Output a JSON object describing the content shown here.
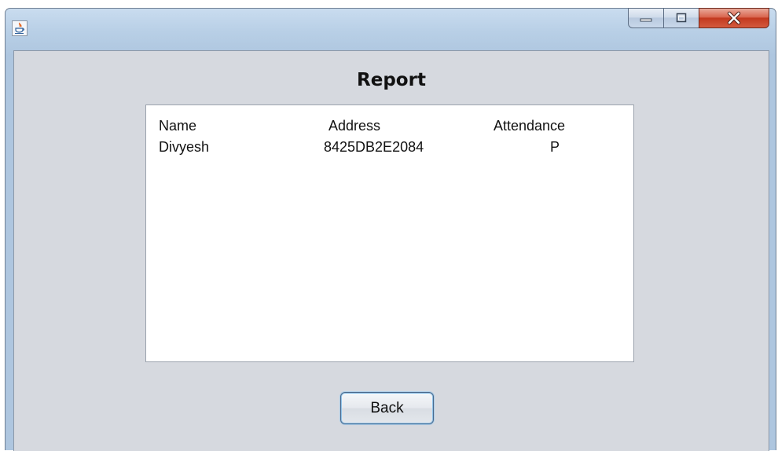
{
  "window": {
    "icon": "java-icon",
    "controls": {
      "minimize_icon": "minimize-icon",
      "maximize_icon": "maximize-icon",
      "close_icon": "close-icon",
      "close_color": "#c2391f"
    }
  },
  "main": {
    "title": "Report",
    "report": {
      "headers": [
        "Name",
        "Address",
        "Attendance"
      ],
      "rows": [
        [
          "Divyesh",
          "8425DB2E2084",
          "P"
        ]
      ]
    },
    "back_label": "Back"
  },
  "colors": {
    "client_background": "#d6d9df",
    "text_area_background": "#ffffff"
  }
}
